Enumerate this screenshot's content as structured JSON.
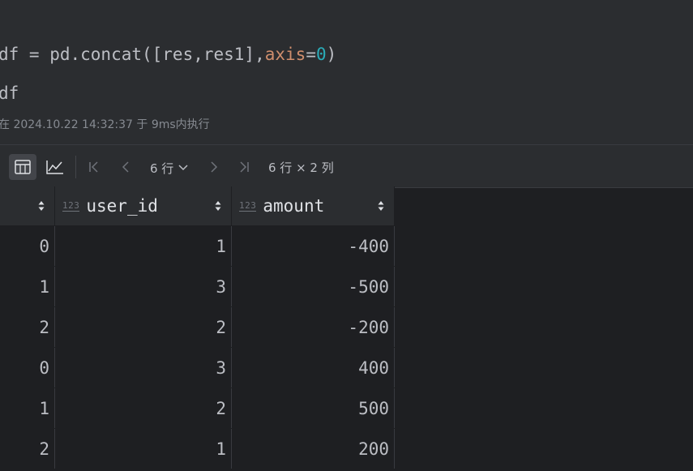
{
  "code": {
    "line1": {
      "prefix": "df = pd.concat([res,res1],",
      "kw": "axis",
      "eq": "=",
      "num": "0",
      "suffix": ")"
    },
    "line2": "df",
    "exec_info": "在 2024.10.22 14:32:37 于 9ms内执行"
  },
  "toolbar": {
    "table_view_icon": "table-icon",
    "chart_view_icon": "chart-icon",
    "rows_label": "6 行",
    "dims_label": "6 行 × 2 列"
  },
  "table": {
    "type_badge": "123",
    "columns": [
      "",
      "user_id",
      "amount"
    ],
    "rows": [
      {
        "index": "0",
        "user_id": "1",
        "amount": "-400"
      },
      {
        "index": "1",
        "user_id": "3",
        "amount": "-500"
      },
      {
        "index": "2",
        "user_id": "2",
        "amount": "-200"
      },
      {
        "index": "0",
        "user_id": "3",
        "amount": "400"
      },
      {
        "index": "1",
        "user_id": "2",
        "amount": "500"
      },
      {
        "index": "2",
        "user_id": "1",
        "amount": "200"
      }
    ]
  },
  "colors": {
    "background": "#2b2d30",
    "output_background": "#1e1f22",
    "keyword": "#cf8e6d",
    "number": "#2aacb8"
  }
}
